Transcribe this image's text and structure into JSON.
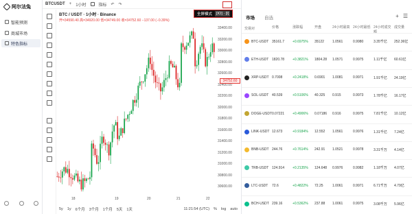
{
  "nav": {
    "logo_text": "阿尔法兔",
    "items": [
      {
        "label": "智能预测"
      },
      {
        "label": "商城市场"
      },
      {
        "label": "特色指标"
      }
    ]
  },
  "chart": {
    "symbol_short": "BTCUSDT",
    "interval": "1小时",
    "indicators": "指标",
    "title": "BTC / USDT · 1小时 · Binance",
    "ohlc": "开=34590.40 高=34920.00 低=34749.00 收=34752.60 −137.00 (−0.39%)",
    "mode_label": "全屏模式",
    "mode_badge": "[IO] · [I]",
    "current_price": "34752.60",
    "price_ticks": [
      "33400.00",
      "33200.00",
      "33000.00",
      "32800.00",
      "32600.00",
      "32400.00",
      "32200.00",
      "32000.00",
      "31800.00",
      "31600.00",
      "31400.00",
      "31200.00",
      "31000.00",
      "30800.00",
      "30600.00"
    ],
    "x_ticks": [
      "18",
      "19",
      "20",
      "21",
      "22"
    ],
    "timeframes": [
      "5y",
      "1y",
      "6个月",
      "3个月",
      "1个月",
      "5天",
      "1天"
    ],
    "time": "11:21:54 (UTC)",
    "pct": "%",
    "log": "log",
    "auto": "auto"
  },
  "chart_data": {
    "type": "candlestick",
    "ylim": [
      30600,
      33400
    ],
    "x_ticks": [
      "18",
      "19",
      "20",
      "21",
      "22"
    ],
    "current_price": 34752.6
  },
  "market": {
    "tabs": [
      "市场",
      "自选"
    ],
    "header": [
      "交易对",
      "价格",
      "涨跌幅",
      "开盘",
      "24小时最高",
      "24小时最低",
      "24小时成交额",
      "成交量"
    ],
    "rows": [
      {
        "pair": "BTC-USDT",
        "price": "35161.7",
        "change": "+0.6975%",
        "open": "35122",
        "high": "1.0561",
        "low": "0.9980",
        "turnover": "3.35千亿",
        "vol": "252.36亿",
        "icon_color": "#f7931a"
      },
      {
        "pair": "ETH-USDT",
        "price": "1820.78",
        "change": "+0.3821%",
        "open": "1804.28",
        "high": "1.0571",
        "low": "0.9975",
        "turnover": "1.11千亿",
        "vol": "60.61亿",
        "icon_color": "#627eea"
      },
      {
        "pair": "XRP-USDT",
        "price": "0.7008",
        "change": "+0.2418%",
        "open": "0.6901",
        "high": "1.0081",
        "low": "0.9971",
        "turnover": "1.91千亿",
        "vol": "24.19亿",
        "icon_color": "#222222"
      },
      {
        "pair": "SOL-USDT",
        "price": "40.539",
        "change": "+0.5106%",
        "open": "40.325",
        "high": "0.915",
        "low": "0.9973",
        "turnover": "1.78千亿",
        "vol": "16.17亿",
        "icon_color": "#9945ff"
      },
      {
        "pair": "DOGE-USDT",
        "price": "0.07221",
        "change": "+0.4906%",
        "open": "0.07186",
        "high": "0.916",
        "low": "0.9975",
        "turnover": "7.81千亿",
        "vol": "10.12亿",
        "icon_color": "#c2a633"
      },
      {
        "pair": "LINK-USDT",
        "price": "12.673",
        "change": "+0.9184%",
        "open": "12.552",
        "high": "1.0561",
        "low": "0.9976",
        "turnover": "1.31千亿",
        "vol": "7.24亿",
        "icon_color": "#2a5ada"
      },
      {
        "pair": "BNB-USDT",
        "price": "244.76",
        "change": "+0.7614%",
        "open": "242.91",
        "high": "1.0521",
        "low": "0.9978",
        "turnover": "3.31千万",
        "vol": "4.14亿",
        "icon_color": "#f3ba2f"
      },
      {
        "pair": "TRB-USDT",
        "price": "124.914",
        "change": "+0.2135%",
        "open": "124.648",
        "high": "0.9976",
        "low": "0.9982",
        "turnover": "1.18千万",
        "vol": "4.07亿",
        "icon_color": "#3ec9a7"
      },
      {
        "pair": "LTC-USDT",
        "price": "72.6",
        "change": "+0.4822%",
        "open": "72.25",
        "high": "1.0061",
        "low": "0.9971",
        "turnover": "6.71千万",
        "vol": "4.79亿",
        "icon_color": "#345d9d"
      },
      {
        "pair": "BCH-USDT",
        "price": "239.16",
        "change": "+0.5362%",
        "open": "237.88",
        "high": "1.0061",
        "low": "0.9975",
        "turnover": "3.08千万",
        "vol": "5.96亿",
        "icon_color": "#0ac18e"
      }
    ]
  }
}
